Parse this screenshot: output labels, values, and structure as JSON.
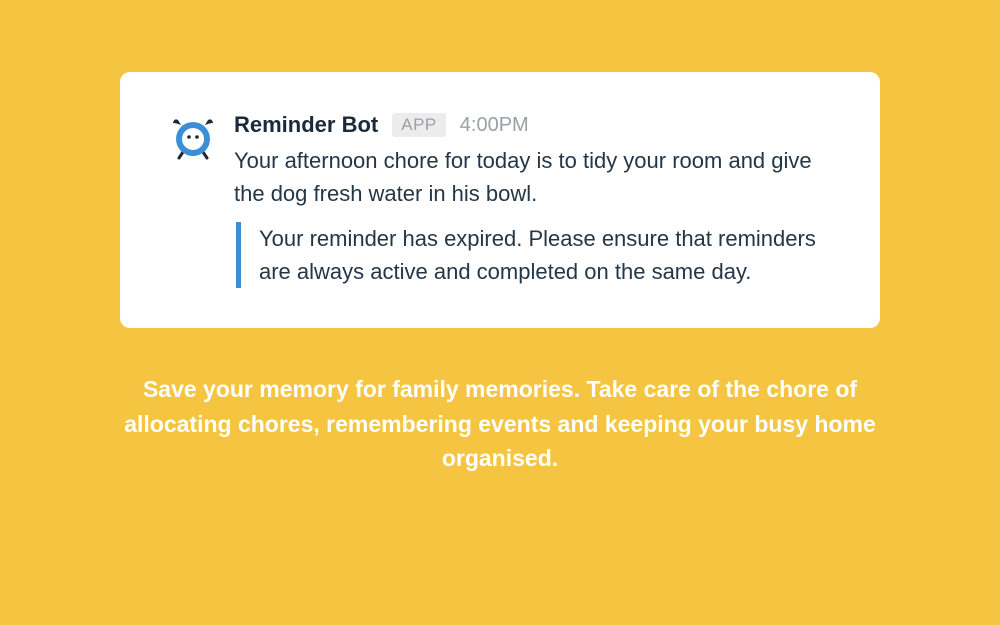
{
  "message": {
    "bot_name": "Reminder Bot",
    "badge": "APP",
    "timestamp": "4:00PM",
    "body": "Your afternoon chore for today is to tidy your room and give the dog fresh water in his bowl.",
    "quote": "Your reminder has expired. Please ensure that reminders are always active and completed on the same day."
  },
  "tagline": "Save your memory for family memories. Take care of the chore of allocating chores, remembering events and keeping your busy home organised.",
  "colors": {
    "background": "#f5c542",
    "accent": "#3a8fd6",
    "text": "#253746"
  }
}
